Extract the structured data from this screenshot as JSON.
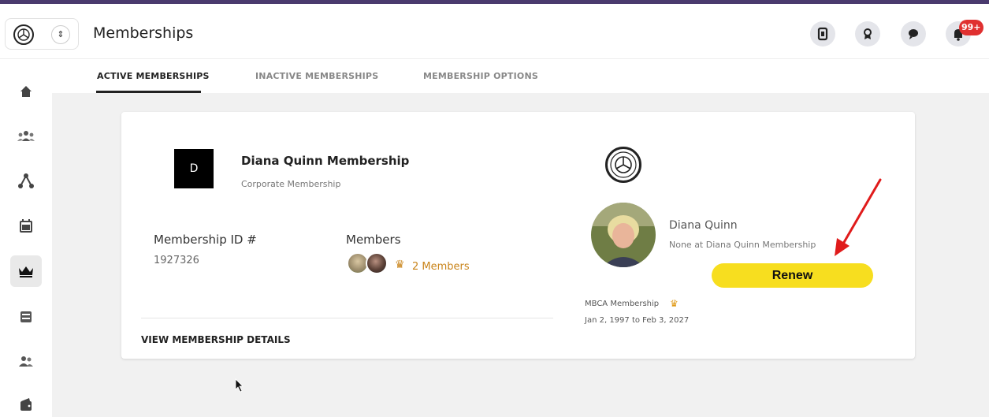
{
  "header": {
    "title": "Memberships",
    "notification_badge": "99+",
    "icons": [
      "badge-icon",
      "award-icon",
      "chat-icon",
      "bell-icon"
    ]
  },
  "tabs": [
    {
      "label": "ACTIVE MEMBERSHIPS",
      "active": true
    },
    {
      "label": "INACTIVE MEMBERSHIPS",
      "active": false
    },
    {
      "label": "MEMBERSHIP OPTIONS",
      "active": false
    }
  ],
  "sidebar": {
    "items": [
      {
        "icon": "home-icon",
        "glyph": "⌂"
      },
      {
        "icon": "community-icon",
        "glyph": "⁂"
      },
      {
        "icon": "network-icon",
        "glyph": "⟑"
      },
      {
        "icon": "calendar-icon",
        "glyph": "▦"
      },
      {
        "icon": "crown-icon",
        "glyph": "♛",
        "active": true
      },
      {
        "icon": "inbox-icon",
        "glyph": "▤"
      },
      {
        "icon": "people-icon",
        "glyph": "⚇"
      },
      {
        "icon": "wallet-icon",
        "glyph": "▣"
      }
    ]
  },
  "membership": {
    "avatar_letter": "D",
    "name": "Diana Quinn Membership",
    "type": "Corporate Membership",
    "id_label": "Membership ID #",
    "id_value": "1927326",
    "members_label": "Members",
    "members_count": "2 Members",
    "details_link": "VIEW MEMBERSHIP DETAILS"
  },
  "person": {
    "name": "Diana Quinn",
    "role": "None at Diana Quinn Membership",
    "renew_label": "Renew",
    "mbca_label": "MBCA Membership",
    "dates": "Jan 2, 1997 to Feb 3, 2027"
  },
  "colors": {
    "accent_bar": "#4a3a6e",
    "renew": "#f7de1f",
    "crown": "#c9841a",
    "badge": "#e03030",
    "annotation_arrow": "#e01b1b"
  }
}
